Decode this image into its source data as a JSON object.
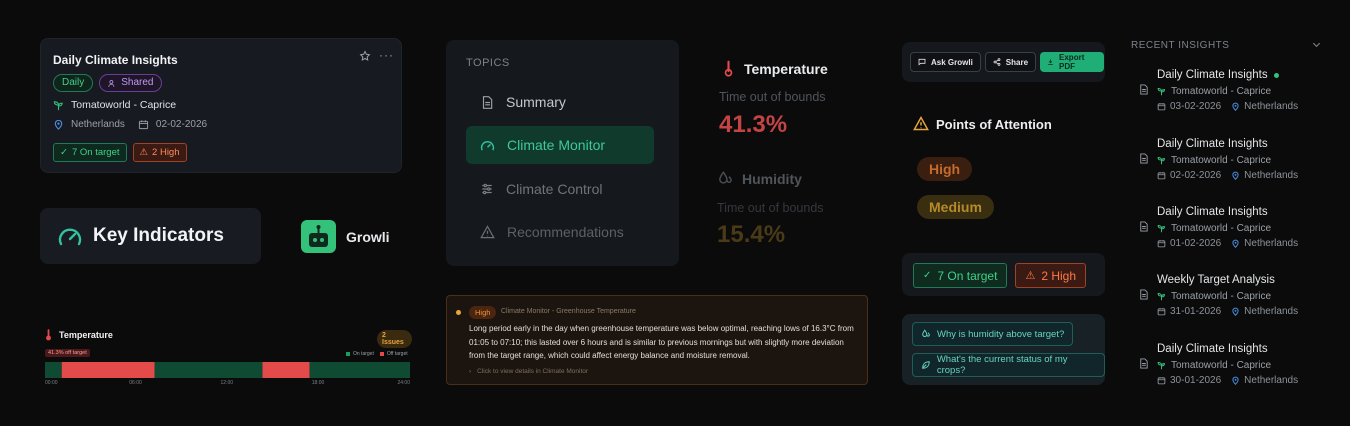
{
  "insight_card": {
    "title": "Daily Climate Insights",
    "tags": [
      "Daily",
      "Shared"
    ],
    "location": "Tomatoworld - Caprice",
    "country": "Netherlands",
    "date": "02-02-2026",
    "on_target": "7 On target",
    "high": "2 High"
  },
  "key_indicators": {
    "title": "Key Indicators"
  },
  "growli": {
    "label": "Growli"
  },
  "temp_chart": {
    "title": "Temperature",
    "issues": "2 Issues",
    "off_target_label": "41.3% off target",
    "legend_on": "On target",
    "legend_off": "Off target",
    "ticks": [
      "00:00",
      "06:00",
      "12:00",
      "18:00",
      "24:00"
    ],
    "colors": {
      "on": "#0f4a33",
      "off": "#e34b4b"
    }
  },
  "chart_data": {
    "type": "bar",
    "title": "Temperature",
    "x_range_hours": [
      0,
      24
    ],
    "segments": [
      {
        "start": 0.0,
        "end": 1.1,
        "status": "on"
      },
      {
        "start": 1.1,
        "end": 7.2,
        "status": "off"
      },
      {
        "start": 7.2,
        "end": 14.3,
        "status": "on"
      },
      {
        "start": 14.3,
        "end": 17.4,
        "status": "off"
      },
      {
        "start": 17.4,
        "end": 24.0,
        "status": "on"
      }
    ]
  },
  "topics": {
    "header": "TOPICS",
    "items": [
      {
        "label": "Summary",
        "icon": "document-icon",
        "active": false
      },
      {
        "label": "Climate Monitor",
        "icon": "gauge-icon",
        "active": true
      },
      {
        "label": "Climate Control",
        "icon": "sliders-icon",
        "active": false
      },
      {
        "label": "Recommendations",
        "icon": "warning-icon",
        "active": false
      }
    ]
  },
  "metrics": {
    "temperature": {
      "label": "Temperature",
      "sub": "Time out of bounds",
      "value": "41.3%"
    },
    "humidity": {
      "label": "Humidity",
      "sub": "Time out of bounds",
      "value": "15.4%"
    }
  },
  "alert": {
    "severity": "High",
    "source": "Climate Monitor - Greenhouse Temperature",
    "text": "Long period early in the day when greenhouse temperature was below optimal, reaching lows of 16.3°C from 01:05 to 07:10; this lasted over 6 hours and is similar to previous mornings but with slightly more deviation from the target range, which could affect energy balance and moisture removal.",
    "link": "Click to view details in Climate Monitor"
  },
  "actions": {
    "ask": "Ask Growli",
    "share": "Share",
    "export": "Export PDF"
  },
  "attention": {
    "title": "Points of Attention",
    "high": "High",
    "medium": "Medium"
  },
  "status": {
    "on_target": "7 On target",
    "high": "2 High"
  },
  "questions": [
    "Why is humidity above target?",
    "What's the current status of my crops?"
  ],
  "recent": {
    "header": "RECENT INSIGHTS",
    "items": [
      {
        "title": "Daily Climate Insights",
        "location": "Tomatoworld - Caprice",
        "date": "03-02-2026",
        "country": "Netherlands",
        "new": true
      },
      {
        "title": "Daily Climate Insights",
        "location": "Tomatoworld - Caprice",
        "date": "02-02-2026",
        "country": "Netherlands",
        "new": false
      },
      {
        "title": "Daily Climate Insights",
        "location": "Tomatoworld - Caprice",
        "date": "01-02-2026",
        "country": "Netherlands",
        "new": false
      },
      {
        "title": "Weekly Target Analysis",
        "location": "Tomatoworld - Caprice",
        "date": "31-01-2026",
        "country": "Netherlands",
        "new": false
      },
      {
        "title": "Daily Climate Insights",
        "location": "Tomatoworld - Caprice",
        "date": "30-01-2026",
        "country": "Netherlands",
        "new": false
      }
    ]
  }
}
